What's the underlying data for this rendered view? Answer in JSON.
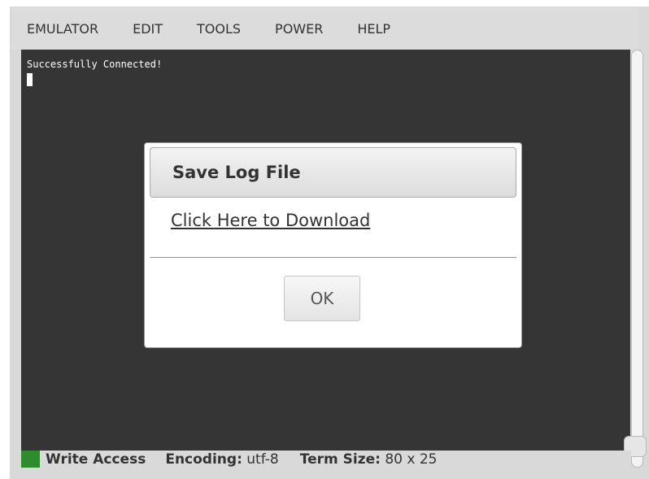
{
  "menu": {
    "items": [
      {
        "label": "EMULATOR"
      },
      {
        "label": "EDIT"
      },
      {
        "label": "TOOLS"
      },
      {
        "label": "POWER"
      },
      {
        "label": "HELP"
      }
    ]
  },
  "terminal": {
    "output_line": "Successfully Connected!",
    "background_color": "#353535",
    "text_color": "#ffffff"
  },
  "dialog": {
    "title": "Save Log File",
    "link_text": "Click Here to Download",
    "ok_label": "OK"
  },
  "statusbar": {
    "write_access": "Write Access",
    "encoding_label": "Encoding:",
    "encoding_value": "utf-8",
    "term_size_label": "Term Size:",
    "term_size_value": "80 x 25",
    "indicator_color": "#2e8b2e"
  }
}
